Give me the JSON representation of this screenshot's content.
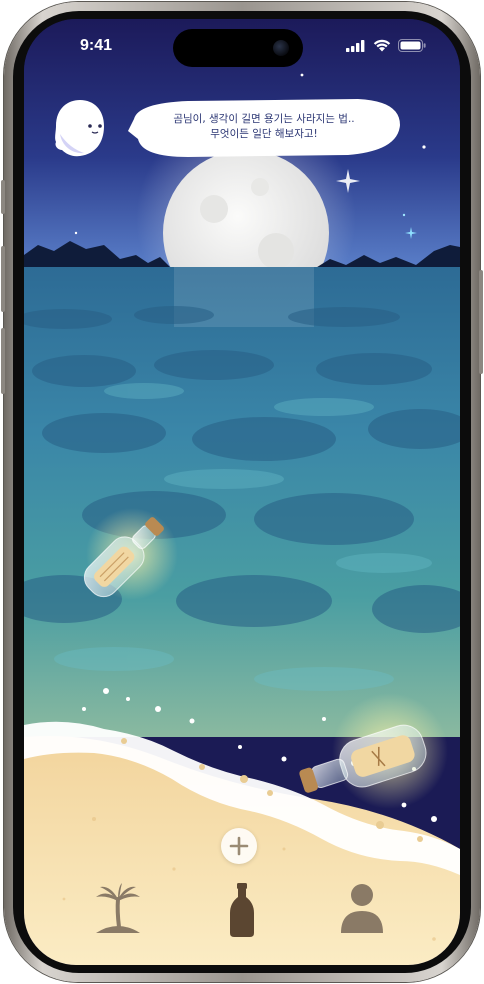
{
  "status_bar": {
    "time": "9:41"
  },
  "speech_bubble": {
    "line1": "곰님이, 생각이 길면 용기는 사라지는 법..",
    "line2": "무엇이든 일단 해보자고!"
  },
  "icons": {
    "ghost": "ghost-character-icon",
    "add": "plus-icon",
    "nav_island": "island-palm-icon",
    "nav_bottle": "bottle-icon",
    "nav_profile": "person-icon"
  },
  "colors": {
    "sky_top": "#1e1c5e",
    "ocean": "#2f7aa0",
    "sand": "#f4dfae",
    "nav_icon": "#8a7a66",
    "nav_icon_active": "#5b4631",
    "bubble_text": "#2c3774"
  }
}
